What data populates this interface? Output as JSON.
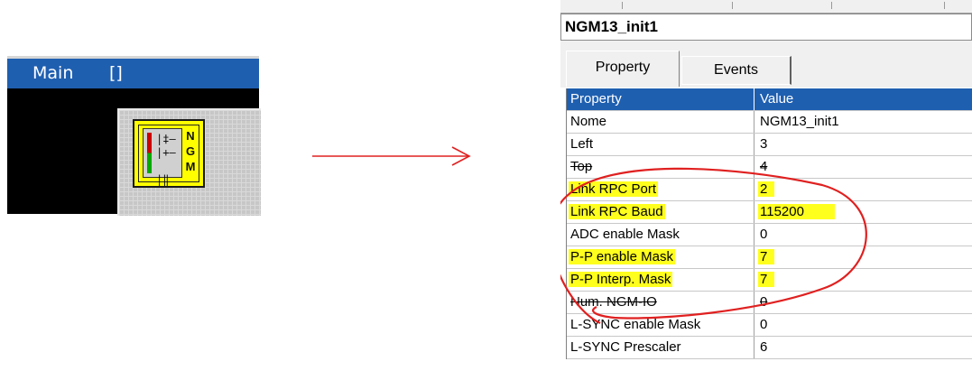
{
  "editor": {
    "title": "Main",
    "title_suffix": "[]",
    "block": {
      "icon": "ngm-block-icon",
      "letters": [
        "N",
        "G",
        "M"
      ],
      "color": "#ffff00"
    }
  },
  "arrow": {
    "color": "#e02020"
  },
  "panel": {
    "object_name": "NGM13_init1",
    "tabs": [
      {
        "label": "Property",
        "selected": true
      },
      {
        "label": "Events",
        "selected": false
      }
    ],
    "header": {
      "property": "Property",
      "value": "Value"
    },
    "rows": [
      {
        "property": "Nome",
        "value": "NGM13_init1",
        "highlight": false
      },
      {
        "property": "Left",
        "value": "3",
        "highlight": false
      },
      {
        "property": "Top",
        "value": "4",
        "highlight": false
      },
      {
        "property": "Link RPC Port",
        "value": "2",
        "highlight": true
      },
      {
        "property": "Link RPC Baud",
        "value": "115200",
        "highlight": true
      },
      {
        "property": "ADC enable Mask",
        "value": "0",
        "highlight": false
      },
      {
        "property": "P-P enable Mask",
        "value": "7",
        "highlight": true
      },
      {
        "property": "P-P Interp. Mask",
        "value": "7",
        "highlight": true
      },
      {
        "property": "Num. NGM-IO",
        "value": "0",
        "highlight": false
      },
      {
        "property": "L-SYNC enable Mask",
        "value": "0",
        "highlight": false
      },
      {
        "property": "L-SYNC Prescaler",
        "value": "6",
        "highlight": false
      }
    ],
    "header_color": "#1f5fb0",
    "highlight_color": "#ffff1e",
    "annotation_color": "#e02020"
  }
}
